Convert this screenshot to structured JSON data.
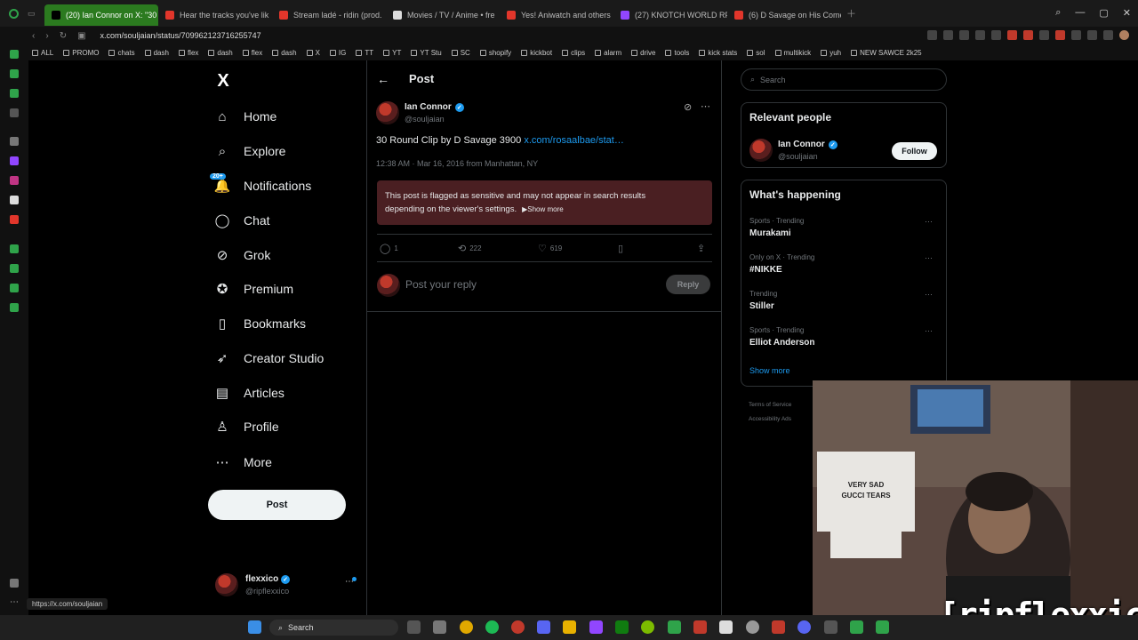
{
  "browser": {
    "tabs": [
      {
        "label": "(20) Ian Connor on X: \"30",
        "color": "#000000",
        "active": true
      },
      {
        "label": "Hear the tracks you've lik",
        "color": "#e2362b",
        "active": false
      },
      {
        "label": "Stream ladé - ridin (prod.",
        "color": "#e2362b",
        "active": false
      },
      {
        "label": "Movies / TV / Anime • fre",
        "color": "#dddddd",
        "active": false
      },
      {
        "label": "Yes! Aniwatch and others",
        "color": "#e2362b",
        "active": false
      },
      {
        "label": "(27) KNOTCH WORLD RP",
        "color": "#9146ff",
        "active": false
      },
      {
        "label": "(6) D Savage on His Come",
        "color": "#e2362b",
        "active": false
      }
    ],
    "url": "x.com/souljaian/status/709962123716255747",
    "bookmarks": [
      "ALL",
      "PROMO",
      "chats",
      "dash",
      "flex",
      "dash",
      "flex",
      "dash",
      "X",
      "IG",
      "TT",
      "YT",
      "YT Stu",
      "SC",
      "shopify",
      "kickbot",
      "clips",
      "alarm",
      "drive",
      "tools",
      "kick stats",
      "sol",
      "multikick",
      "yuh",
      "NEW SAWCE 2k25"
    ],
    "status_url": "https://x.com/souljaian"
  },
  "nav": {
    "logo": "X",
    "items": [
      {
        "label": "Home",
        "icon": "home-icon",
        "glyph": "⌂"
      },
      {
        "label": "Explore",
        "icon": "search-icon",
        "glyph": "⌕"
      },
      {
        "label": "Notifications",
        "icon": "bell-icon",
        "glyph": "🔔"
      },
      {
        "label": "Chat",
        "icon": "chat-icon",
        "glyph": "◯"
      },
      {
        "label": "Grok",
        "icon": "grok-icon",
        "glyph": "⊘"
      },
      {
        "label": "Premium",
        "icon": "premium-icon",
        "glyph": "✪"
      },
      {
        "label": "Bookmarks",
        "icon": "bookmark-icon",
        "glyph": "▯"
      },
      {
        "label": "Creator Studio",
        "icon": "rocket-icon",
        "glyph": "➶"
      },
      {
        "label": "Articles",
        "icon": "articles-icon",
        "glyph": "▤"
      },
      {
        "label": "Profile",
        "icon": "profile-icon",
        "glyph": "♙"
      },
      {
        "label": "More",
        "icon": "more-icon",
        "glyph": "⋯"
      }
    ],
    "notifications_badge": "20+",
    "post_button": "Post",
    "account": {
      "name": "flexxico",
      "handle": "@ripflexxico"
    }
  },
  "post": {
    "header_title": "Post",
    "author_name": "Ian Connor",
    "author_handle": "@souljaian",
    "text": "30 Round Clip by D Savage 3900 ",
    "link": "x.com/rosaalbae/stat…",
    "meta": "12:38 AM · Mar 16, 2016 from Manhattan, NY",
    "sensitive_notice": "This post is flagged as sensitive and may not appear in search results depending on the viewer's settings.",
    "show_more": "▶Show more",
    "replies": "1",
    "reposts": "222",
    "likes": "619",
    "reply_placeholder": "Post your reply",
    "reply_button": "Reply"
  },
  "sidebar": {
    "search_placeholder": "Search",
    "relevant_title": "Relevant people",
    "relevant_name": "Ian Connor",
    "relevant_handle": "@souljaian",
    "follow_label": "Follow",
    "happening_title": "What's happening",
    "trends": [
      {
        "category": "Sports · Trending",
        "title": "Murakami"
      },
      {
        "category": "Only on X · Trending",
        "title": "#NIKKE"
      },
      {
        "category": "Trending",
        "title": "Stiller"
      },
      {
        "category": "Sports · Trending",
        "title": "Elliot Anderson"
      }
    ],
    "show_more": "Show more",
    "footer1": "Terms of Service",
    "footer2": "Accessibility   Ads"
  },
  "overlay": {
    "watermark": "[ripflexxico]"
  },
  "taskbar": {
    "search_label": "Search"
  },
  "colors": {
    "accent": "#1d9bf0",
    "sensitive_bg": "#4a1f22",
    "opera_green": "#2fa34a"
  }
}
